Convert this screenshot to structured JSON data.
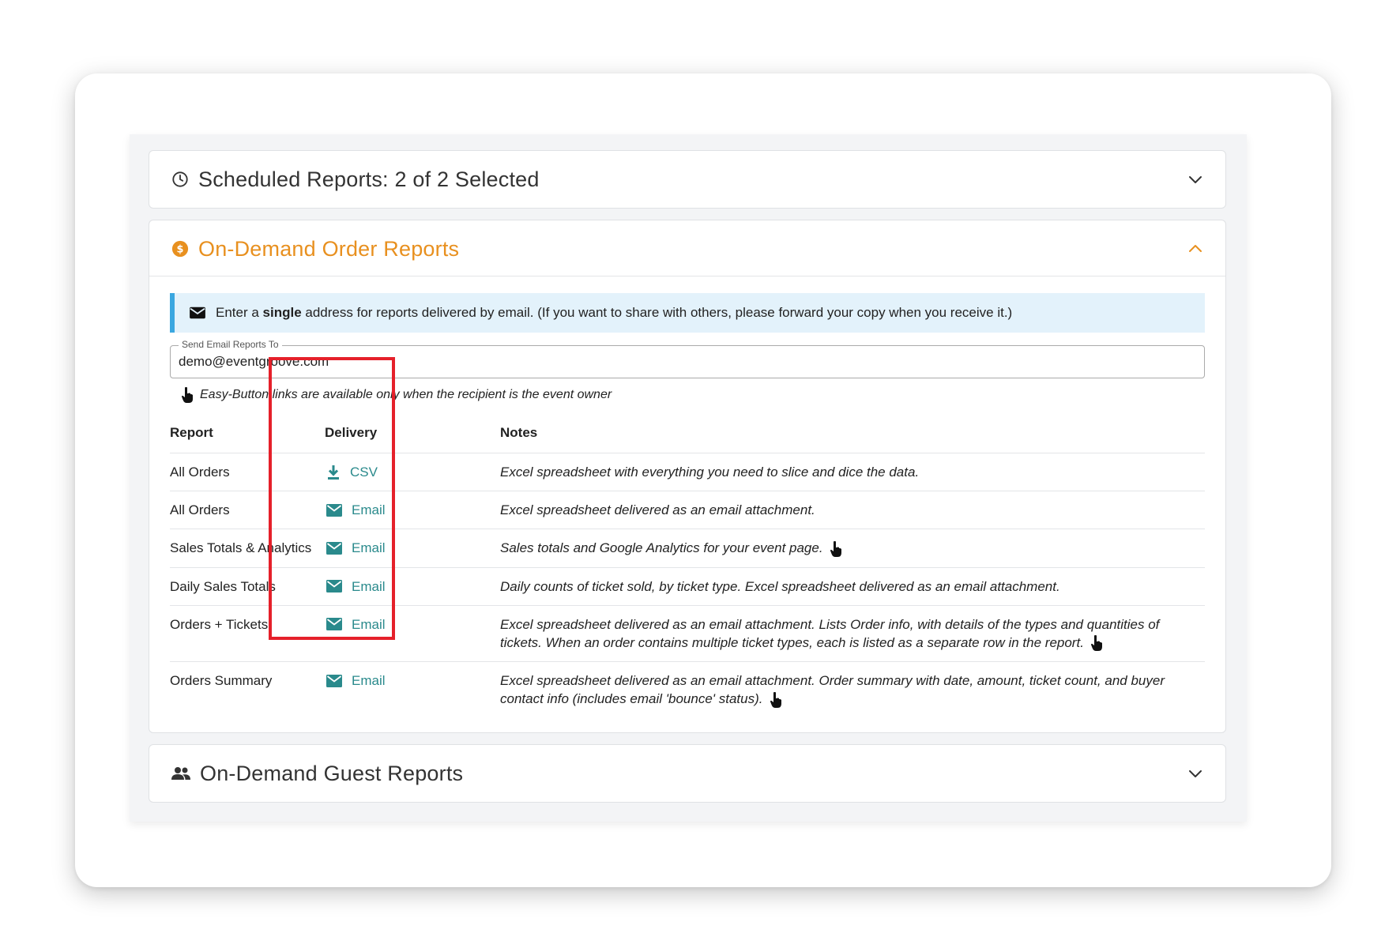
{
  "panels": {
    "scheduled": {
      "title": "Scheduled Reports: 2 of 2 Selected",
      "icon": "clock-icon",
      "state": "collapsed"
    },
    "order": {
      "title": "On-Demand Order Reports",
      "icon": "dollar-coin-icon",
      "state": "expanded"
    },
    "guest": {
      "title": "On-Demand Guest Reports",
      "icon": "people-icon",
      "state": "collapsed"
    }
  },
  "alert": {
    "icon": "envelope-icon",
    "text_before": "Enter a ",
    "text_bold": "single",
    "text_after": " address for reports delivered by email. (If you want to share with others, please forward your copy when you receive it.)"
  },
  "email_field": {
    "label": "Send Email Reports To",
    "value": "demo@eventgroove.com"
  },
  "hint": {
    "icon": "pointer-hand-icon",
    "text": "Easy-Button links are available only when the recipient is the event owner"
  },
  "table": {
    "headers": {
      "report": "Report",
      "delivery": "Delivery",
      "notes": "Notes"
    },
    "rows": [
      {
        "report": "All Orders",
        "delivery": "CSV",
        "delivery_icon": "download-icon",
        "notes": "Excel spreadsheet with everything you need to slice and dice the data.",
        "easy_button": false
      },
      {
        "report": "All Orders",
        "delivery": "Email",
        "delivery_icon": "envelope-icon",
        "notes": "Excel spreadsheet delivered as an email attachment.",
        "easy_button": false
      },
      {
        "report": "Sales Totals & Analytics",
        "delivery": "Email",
        "delivery_icon": "envelope-icon",
        "notes": "Sales totals and Google Analytics for your event page.",
        "easy_button": true
      },
      {
        "report": "Daily Sales Totals",
        "delivery": "Email",
        "delivery_icon": "envelope-icon",
        "notes": "Daily counts of ticket sold, by ticket type. Excel spreadsheet delivered as an email attachment.",
        "easy_button": false
      },
      {
        "report": "Orders + Tickets",
        "delivery": "Email",
        "delivery_icon": "envelope-icon",
        "notes": "Excel spreadsheet delivered as an email attachment. Lists Order info, with details of the types and quantities of tickets. When an order contains multiple ticket types, each is listed as a separate row in the report.",
        "easy_button": true
      },
      {
        "report": "Orders Summary",
        "delivery": "Email",
        "delivery_icon": "envelope-icon",
        "notes": "Excel spreadsheet delivered as an email attachment. Order summary with date, amount, ticket count, and buyer contact info (includes email 'bounce' status).",
        "easy_button": true
      }
    ]
  },
  "colors": {
    "accent_orange": "#e8901f",
    "link_teal": "#2a8a8c",
    "alert_bg": "#e3f2fb",
    "alert_border": "#3aa7e0",
    "highlight_red": "#e5202a"
  }
}
